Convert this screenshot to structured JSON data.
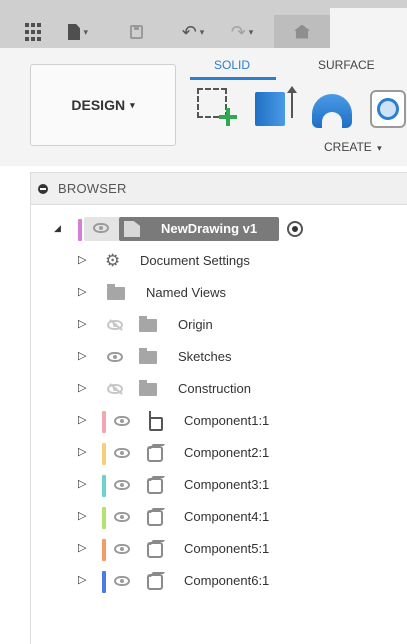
{
  "toolbar": {
    "icons": [
      "app-grid-icon",
      "file-icon",
      "save-icon",
      "undo-icon",
      "redo-icon",
      "home-icon"
    ],
    "undo_glyph": "↶",
    "redo_glyph": "↷",
    "caret": "▾"
  },
  "ribbon": {
    "workspace_label": "DESIGN",
    "tabs": [
      {
        "label": "SOLID",
        "active": true
      },
      {
        "label": "SURFACE",
        "active": false
      }
    ],
    "create_label": "CREATE",
    "tools": [
      "create-sketch-icon",
      "extrude-icon",
      "revolve-icon",
      "hole-icon"
    ]
  },
  "browser": {
    "title": "BROWSER",
    "root": {
      "name": "NewDrawing v1",
      "color": "#d77fd8"
    },
    "items": [
      {
        "label": "Document Settings",
        "icon": "gear-icon"
      },
      {
        "label": "Named Views",
        "icon": "folder-icon"
      },
      {
        "label": "Origin",
        "icon": "folder-icon",
        "visible": false
      },
      {
        "label": "Sketches",
        "icon": "folder-icon",
        "visible": true
      },
      {
        "label": "Construction",
        "icon": "folder-icon",
        "visible": false
      }
    ],
    "components": [
      {
        "label": "Component1:1",
        "color": "#f4a7b0"
      },
      {
        "label": "Component2:1",
        "color": "#f6cf7a"
      },
      {
        "label": "Component3:1",
        "color": "#6fd0cc"
      },
      {
        "label": "Component4:1",
        "color": "#b4e36f"
      },
      {
        "label": "Component5:1",
        "color": "#f59a62"
      },
      {
        "label": "Component6:1",
        "color": "#4d79e6"
      }
    ]
  },
  "colors": {
    "accent": "#2b7fd1",
    "toolbar_bg": "#cfcfcf",
    "ribbon_bg": "#f4f4f4"
  }
}
